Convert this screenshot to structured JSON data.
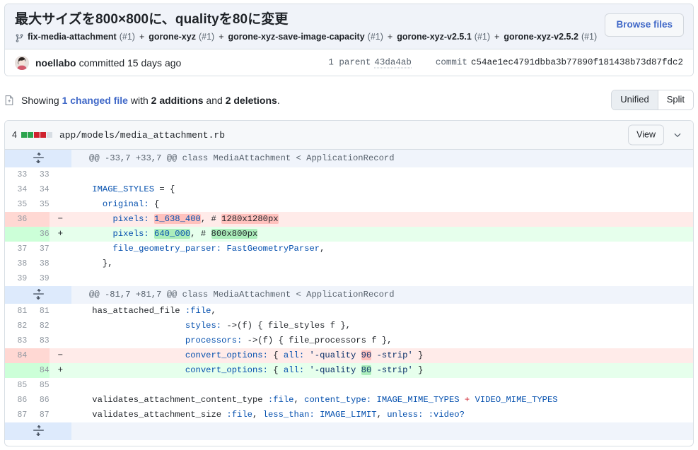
{
  "commit": {
    "title": "最大サイズを800×800に、qualityを80に変更",
    "branch_icon": "git-branch-icon",
    "refs": [
      {
        "name": "fix-media-attachment",
        "num": "(#1)"
      },
      {
        "name": "gorone-xyz",
        "num": "(#1)"
      },
      {
        "name": "gorone-xyz-save-image-capacity",
        "num": "(#1)"
      },
      {
        "name": "gorone-xyz-v2.5.1",
        "num": "(#1)"
      },
      {
        "name": "gorone-xyz-v2.5.2",
        "num": "(#1)"
      }
    ],
    "ref_separator": "+",
    "browse_files_label": "Browse files",
    "author": "noellabo",
    "committed_text": "committed 15 days ago",
    "parent_label": "1 parent",
    "parent_sha": "43da4ab",
    "commit_label": "commit",
    "commit_sha": "c54ae1ec4791dbba3b77890f181438b73d87fdc2"
  },
  "showing": {
    "icon": "file-diff-icon",
    "prefix": "Showing ",
    "changed_files_link": "1 changed file",
    "middle": " with ",
    "additions": "2 additions",
    "and": " and ",
    "deletions": "2 deletions",
    "suffix": ".",
    "view_unified": "Unified",
    "view_split": "Split"
  },
  "file": {
    "stat_count": "4",
    "stat_blocks": [
      "add",
      "add",
      "del",
      "del",
      "neutral"
    ],
    "path": "app/models/media_attachment.rb",
    "view_label": "View",
    "chevron_icon": "chevron-down-icon",
    "expand_icon": "unfold-icon"
  },
  "diff": {
    "rows": [
      {
        "type": "hunk",
        "text": "@@ -33,7 +33,7 @@ class MediaAttachment < ApplicationRecord"
      },
      {
        "type": "ctx",
        "old": "33",
        "new": "33",
        "marker": "",
        "code": ""
      },
      {
        "type": "ctx",
        "old": "34",
        "new": "34",
        "marker": "",
        "code": "    IMAGE_STYLES = {"
      },
      {
        "type": "ctx",
        "old": "35",
        "new": "35",
        "marker": "",
        "code": "      original: {"
      },
      {
        "type": "del",
        "old": "36",
        "new": "",
        "marker": "−",
        "code": "        pixels: 1_638_400, # 1280x1280px"
      },
      {
        "type": "add",
        "old": "",
        "new": "36",
        "marker": "+",
        "code": "        pixels: 640_000, # 800x800px"
      },
      {
        "type": "ctx",
        "old": "37",
        "new": "37",
        "marker": "",
        "code": "        file_geometry_parser: FastGeometryParser,"
      },
      {
        "type": "ctx",
        "old": "38",
        "new": "38",
        "marker": "",
        "code": "      },"
      },
      {
        "type": "ctx",
        "old": "39",
        "new": "39",
        "marker": "",
        "code": ""
      },
      {
        "type": "hunk",
        "text": "@@ -81,7 +81,7 @@ class MediaAttachment < ApplicationRecord"
      },
      {
        "type": "ctx",
        "old": "81",
        "new": "81",
        "marker": "",
        "code": "    has_attached_file :file,"
      },
      {
        "type": "ctx",
        "old": "82",
        "new": "82",
        "marker": "",
        "code": "                      styles: ->(f) { file_styles f },"
      },
      {
        "type": "ctx",
        "old": "83",
        "new": "83",
        "marker": "",
        "code": "                      processors: ->(f) { file_processors f },"
      },
      {
        "type": "del",
        "old": "84",
        "new": "",
        "marker": "−",
        "code": "                      convert_options: { all: '-quality 90 -strip' }"
      },
      {
        "type": "add",
        "old": "",
        "new": "84",
        "marker": "+",
        "code": "                      convert_options: { all: '-quality 80 -strip' }"
      },
      {
        "type": "ctx",
        "old": "85",
        "new": "85",
        "marker": "",
        "code": ""
      },
      {
        "type": "ctx",
        "old": "86",
        "new": "86",
        "marker": "",
        "code": "    validates_attachment_content_type :file, content_type: IMAGE_MIME_TYPES + VIDEO_MIME_TYPES"
      },
      {
        "type": "ctx",
        "old": "87",
        "new": "87",
        "marker": "",
        "code": "    validates_attachment_size :file, less_than: IMAGE_LIMIT, unless: :video?"
      },
      {
        "type": "hunk-empty",
        "text": ""
      }
    ]
  },
  "colors": {
    "accent": "#4169c8",
    "add_bg": "#e6ffec",
    "add_gutter": "#ccffd8",
    "add_word": "#aceebb",
    "del_bg": "#ffebe9",
    "del_gutter": "#ffd8d3",
    "del_word": "#ffc1bd",
    "hunk_bg": "#f0f4fb",
    "header_bg": "#f0f3f9",
    "border": "#d8dee4"
  }
}
